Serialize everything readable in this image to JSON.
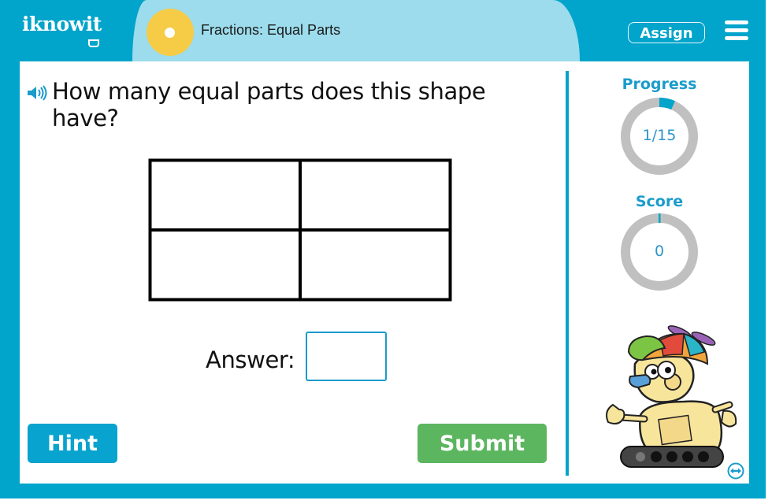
{
  "header": {
    "logo_text": "iknowit",
    "lesson_title": "Fractions: Equal Parts",
    "assign_label": "Assign",
    "menu_icon": "hamburger-menu-icon",
    "sun_icon": "sun-icon"
  },
  "question": {
    "audio_icon": "speaker-icon",
    "text": "How many equal parts does this shape have?",
    "shape": {
      "type": "rectangle-grid",
      "rows": 2,
      "columns": 2,
      "parts": 4
    }
  },
  "answer": {
    "label": "Answer:",
    "value": "",
    "placeholder": ""
  },
  "buttons": {
    "hint_label": "Hint",
    "submit_label": "Submit"
  },
  "sidebar": {
    "progress": {
      "label": "Progress",
      "display": "1/15",
      "current": 1,
      "total": 15
    },
    "score": {
      "label": "Score",
      "display": "0",
      "value": 0
    },
    "mascot": "robot-mascot",
    "swap_icon": "swap-horizontal-icon"
  },
  "colors": {
    "brand_blue": "#01a4ca",
    "title_band": "#9cdcec",
    "sun_yellow": "#f6cb46",
    "hint_blue": "#08a3ce",
    "submit_green": "#5cb55f",
    "ring_gray": "#c0c0c0"
  }
}
